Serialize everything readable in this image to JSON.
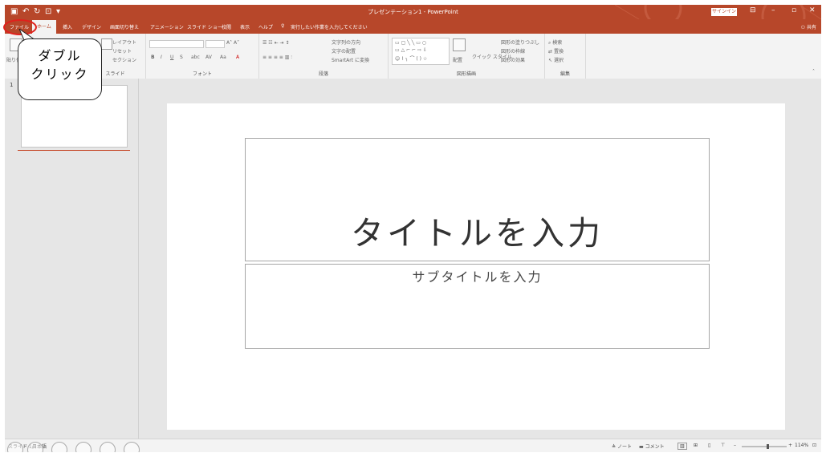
{
  "window": {
    "title": "プレゼンテーション1 - PowerPoint",
    "sign_in": "サインイン",
    "share": "共有"
  },
  "tabs": [
    {
      "label": "ファイル"
    },
    {
      "label": "ホーム"
    },
    {
      "label": "挿入"
    },
    {
      "label": "デザイン"
    },
    {
      "label": "画面切り替え"
    },
    {
      "label": "アニメーション"
    },
    {
      "label": "スライド ショー"
    },
    {
      "label": "校閲"
    },
    {
      "label": "表示"
    },
    {
      "label": "ヘルプ"
    }
  ],
  "tell_me": "実行したい作業を入力してください",
  "ribbon": {
    "paste": "貼り付け",
    "layout": "レイアウト",
    "reset": "リセット",
    "section": "セクション",
    "group_slide": "スライド",
    "group_font": "フォント",
    "group_paragraph": "段落",
    "text_direction": "文字列の方向",
    "align_text": "文字の配置",
    "smartart": "SmartArt に変換",
    "arrange": "配置",
    "quick_styles": "クイック スタイル",
    "shape_fill": "図形の塗りつぶし",
    "shape_outline": "図形の枠線",
    "shape_effects": "図形の効果",
    "group_drawing": "図形描画",
    "find": "検索",
    "replace": "置換",
    "select": "選択",
    "group_editing": "編集"
  },
  "thumbnails": {
    "slide_number": "1"
  },
  "slide": {
    "title_placeholder": "タイトルを入力",
    "subtitle_placeholder": "サブタイトルを入力"
  },
  "status": {
    "slide_info": "スライド 1/1",
    "language": "日本語",
    "notes": "ノート",
    "comments": "コメント",
    "zoom": "114%"
  },
  "annotation": {
    "callout_text": "ダブル\nクリック"
  },
  "colors": {
    "accent": "#b7472a",
    "highlight_ring": "#e0201c"
  }
}
